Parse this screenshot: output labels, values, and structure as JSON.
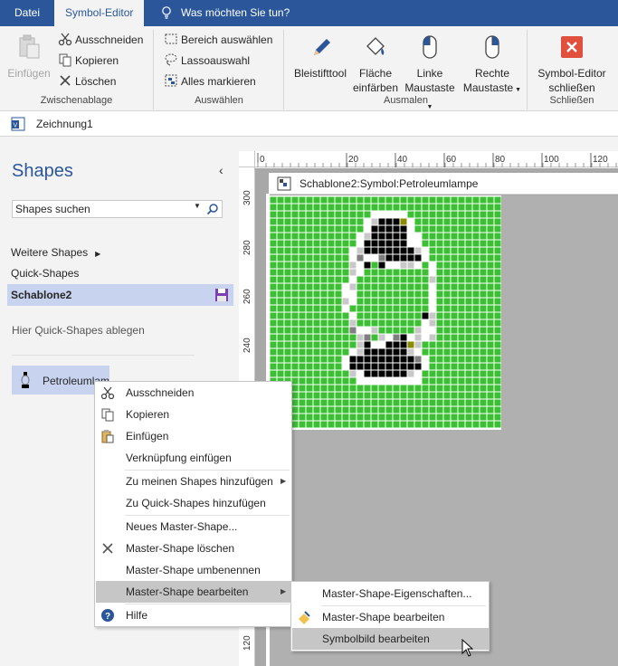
{
  "tabs": {
    "file": "Datei",
    "symbol_editor": "Symbol-Editor",
    "tell_me": "Was möchten Sie tun?"
  },
  "ribbon": {
    "clipboard": {
      "paste": "Einfügen",
      "cut": "Ausschneiden",
      "copy": "Kopieren",
      "delete": "Löschen",
      "label": "Zwischenablage"
    },
    "select": {
      "area": "Bereich auswählen",
      "lasso": "Lassoauswahl",
      "select_all": "Alles markieren",
      "label": "Auswählen"
    },
    "paint": {
      "pencil": "Bleistifttool",
      "fill_1": "Fläche",
      "fill_2": "einfärben",
      "left_1": "Linke",
      "left_2": "Maustaste",
      "right_1": "Rechte",
      "right_2": "Maustaste",
      "label": "Ausmalen"
    },
    "close": {
      "line1": "Symbol-Editor",
      "line2": "schließen",
      "label": "Schließen"
    }
  },
  "document": {
    "name": "Zeichnung1"
  },
  "shapes_pane": {
    "title": "Shapes",
    "search_value": "Shapes suchen",
    "more_shapes": "Weitere Shapes",
    "quick_shapes": "Quick-Shapes",
    "stencil": "Schablone2",
    "hint": "Hier Quick-Shapes ablegen",
    "master_name": "Petroleumlampe"
  },
  "ruler": {
    "h_ticks": [
      "0",
      "20",
      "40",
      "60",
      "80",
      "100",
      "120"
    ],
    "v_ticks": [
      "300",
      "280",
      "260",
      "240",
      "120"
    ]
  },
  "editor": {
    "title": "Schablone2:Symbol:Petroleumlampe"
  },
  "context_menu": {
    "cut": "Ausschneiden",
    "copy": "Kopieren",
    "paste": "Einfügen",
    "paste_link": "Verknüpfung einfügen",
    "add_my_shapes": "Zu meinen Shapes hinzufügen",
    "add_quick_shapes": "Zu Quick-Shapes hinzufügen",
    "new_master": "Neues Master-Shape...",
    "delete_master": "Master-Shape löschen",
    "rename_master": "Master-Shape umbenennen",
    "edit_master": "Master-Shape bearbeiten",
    "help": "Hilfe"
  },
  "submenu": {
    "properties": "Master-Shape-Eigenschaften...",
    "edit_master": "Master-Shape bearbeiten",
    "edit_icon": "Symbolbild bearbeiten"
  },
  "icon_grid": {
    "rows": [
      "GGGGGGGGGGGGGGGGGGGGGGGGGGGGGGGG",
      "GGGGGGGGGGGGGGGGGGGGGGGGGGGGGGGG",
      "GGGGGGGGGGGGGGWWWWWGGGGGGGGGGGGG",
      "GGGGGGGGGGGGGWLKKKOWGGGGGGGGGGGG",
      "GGGGGGGGGGGGGWKKKKKWGGGGGGGGGGGG",
      "GGGGGGGGGGGGWLKKKKKWWGGGGGGGGGGG",
      "GGGGGGGGGGGGWKKKKKKWWGGGGGGGGGGG",
      "GGGGGGGGGGGWLKKKKKKKLWGGGGGGGGGG",
      "GGGGGGGGGGGWDWWDKKKKKWGGGGGGGGGG",
      "GGGGGGGGGGGLWKGKWWLLWGWGGGGGGGGG",
      "GGGGGGGGGGGLWGGGGGGGGGWGGGGGGGGG",
      "GGGGGGGGGGGWGGGGGGGGGGLGGGGGGGGG",
      "GGGGGGGGGGWLGGGGGGGGGGWGGGGGGGGG",
      "GGGGGGGGGGWWGGGGGGGGGGWGGGGGGGGG",
      "GGGGGGGGGGLWGGGGGGGGGGWGGGGGGGGG",
      "GGGGGGGGGGWGGGGGGGGGGGWGGGGGGGGG",
      "GGGGGGGGGGGWGGGGGGGGGKLGGGGGGGGG",
      "GGGGGGGGGGGLGGGGGGGGGWLGGGGGGGGG",
      "GGGGGGGGGGGDWWLGGGGGLWWGGGGGGGGG",
      "GGGGGGGGGGGGLDGLWDKWLWLGGGGGGGGG",
      "GGGGGGGGGGGGLKWWKKKOLGGGGGGGGGGG",
      "GGGGGGGGGGGWLKKKKKKLWGGGGGGGGGGG",
      "GGGGGGGGGGWKKKKKKKKKDWGGGGGGGGGG",
      "GGGGGGGGGGWKKKKKKKKKKWGGGGGGGGGG",
      "GGGGGGGGGGGLWKKKKKKLWGGGGGGGGGGG",
      "GGGGGGGGGGGGWWWWWWWWWGGGGGGGGGGG",
      "GGGGGGGGGGGGGGGGGGGGGGGGGGGGGGGG",
      "GGGGGGGGGGGGGGGGGGGGGGGGGGGGGGGG",
      "GGGGGGGGGGGGGGGGGGGGGGGGGGGGGGGG",
      "GGGGGGGGGGGGGGGGGGGGGGGGGGGGGGGG",
      "GGGGGGGGGGGGGGGGGGGGGGGGGGGGGGGG",
      "GGGGGGGGGGGGGGGGGGGGGGGGGGGGGGGG"
    ],
    "colors": {
      "G": "#3bbf33",
      "W": "#ffffff",
      "K": "#000000",
      "L": "#c8c8c8",
      "D": "#7f7f7f",
      "O": "#8c8c00"
    }
  }
}
